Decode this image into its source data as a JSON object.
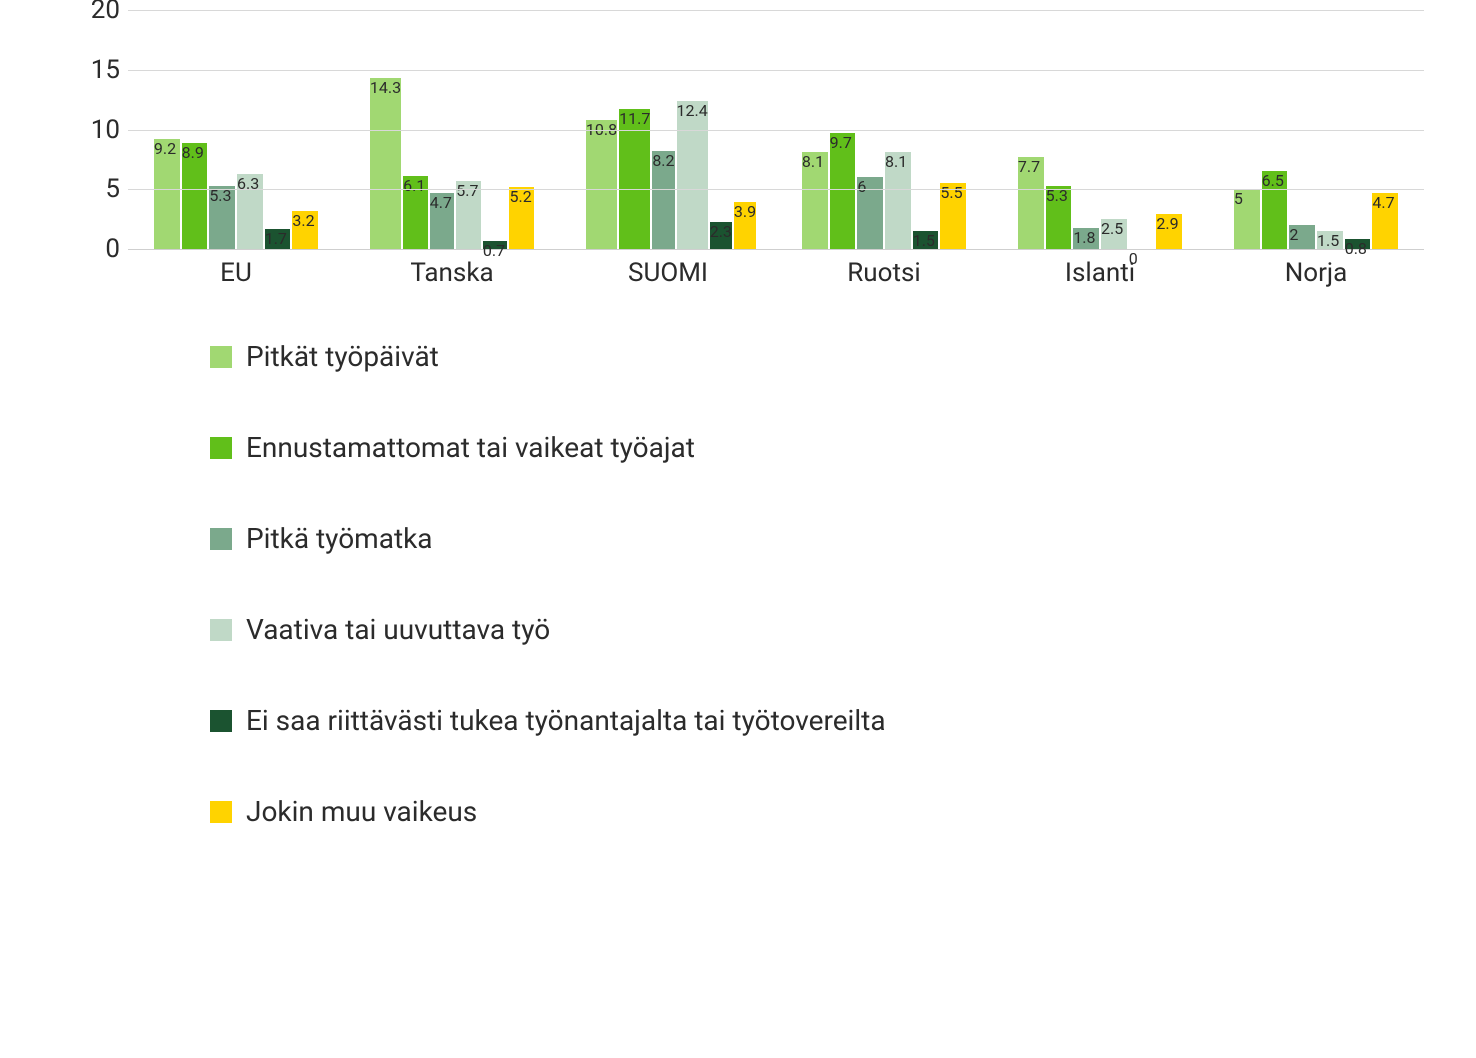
{
  "chart_data": {
    "type": "bar",
    "title": "",
    "xlabel": "",
    "ylabel": "",
    "ylim": [
      0,
      20
    ],
    "yticks": [
      0,
      5,
      10,
      15,
      20
    ],
    "categories": [
      "EU",
      "Tanska",
      "SUOMI",
      "Ruotsi",
      "Islanti",
      "Norja"
    ],
    "series": [
      {
        "name": "Pitkät työpäivät",
        "color": "#a1d872",
        "values": [
          9.2,
          14.3,
          10.8,
          8.1,
          7.7,
          5.0
        ]
      },
      {
        "name": "Ennustamattomat tai vaikeat työajat",
        "color": "#61bf1a",
        "values": [
          8.9,
          6.1,
          11.7,
          9.7,
          5.3,
          6.5
        ]
      },
      {
        "name": "Pitkä työmatka",
        "color": "#7ba98c",
        "values": [
          5.3,
          4.7,
          8.2,
          6.0,
          1.8,
          2.0
        ]
      },
      {
        "name": "Vaativa tai uuvuttava työ",
        "color": "#c0d9c7",
        "values": [
          6.3,
          5.7,
          12.4,
          8.1,
          2.5,
          1.5
        ]
      },
      {
        "name": "Ei saa riittävästi tukea työnantajalta tai työtovereilta",
        "color": "#1b5330",
        "values": [
          1.7,
          0.7,
          2.3,
          1.5,
          0.0,
          0.8
        ]
      },
      {
        "name": "Jokin muu vaikeus",
        "color": "#ffd300",
        "values": [
          3.2,
          5.2,
          3.9,
          5.5,
          2.9,
          4.7
        ]
      }
    ]
  }
}
